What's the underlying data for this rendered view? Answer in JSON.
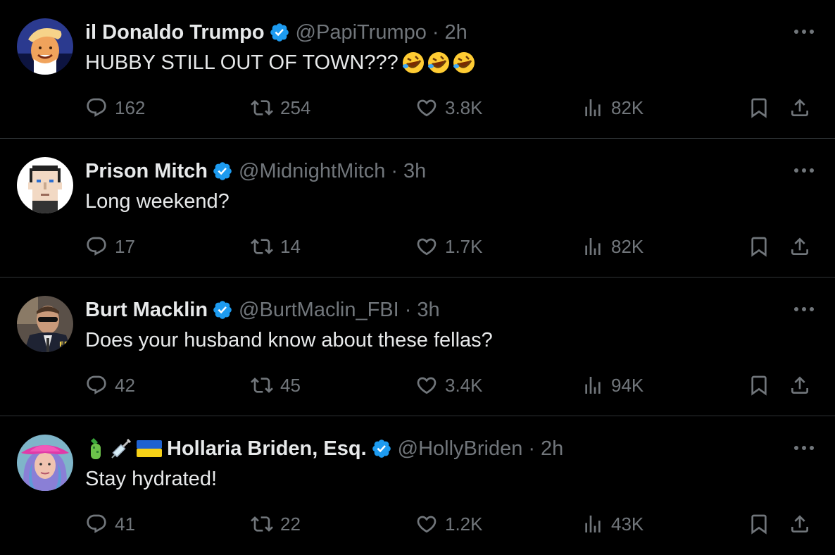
{
  "tweets": [
    {
      "name": "il Donaldo Trumpo",
      "handle": "@PapiTrumpo",
      "time": "2h",
      "text": "HUBBY STILL OUT OF TOWN???",
      "text_emoji": "🤣🤣🤣",
      "avatar_icon": "trump-caricature-avatar",
      "replies": "162",
      "retweets": "254",
      "likes": "3.8K",
      "views": "82K"
    },
    {
      "name": "Prison Mitch",
      "handle": "@MidnightMitch",
      "time": "3h",
      "text": "Long weekend?",
      "avatar_icon": "pixel-art-face-avatar",
      "replies": "17",
      "retweets": "14",
      "likes": "1.7K",
      "views": "82K"
    },
    {
      "name": "Burt Macklin",
      "handle": "@BurtMaclin_FBI",
      "time": "3h",
      "text": "Does your husband know about these fellas?",
      "avatar_icon": "fbi-agent-avatar",
      "replies": "42",
      "retweets": "45",
      "likes": "3.4K",
      "views": "94K"
    },
    {
      "name": "Hollaria Briden, Esq.",
      "name_emoji": [
        "cucumber-emoji",
        "syringe-emoji",
        "ukraine-flag-emoji"
      ],
      "handle": "@HollyBriden",
      "time": "2h",
      "text": "Stay hydrated!",
      "avatar_icon": "pink-hat-woman-avatar",
      "replies": "41",
      "retweets": "22",
      "likes": "1.2K",
      "views": "43K"
    }
  ],
  "separator": "·",
  "colors": {
    "background": "#000000",
    "text": "#e7e9ea",
    "muted": "#71767b",
    "verified": "#1d9bf0",
    "divider": "#2f3336"
  }
}
